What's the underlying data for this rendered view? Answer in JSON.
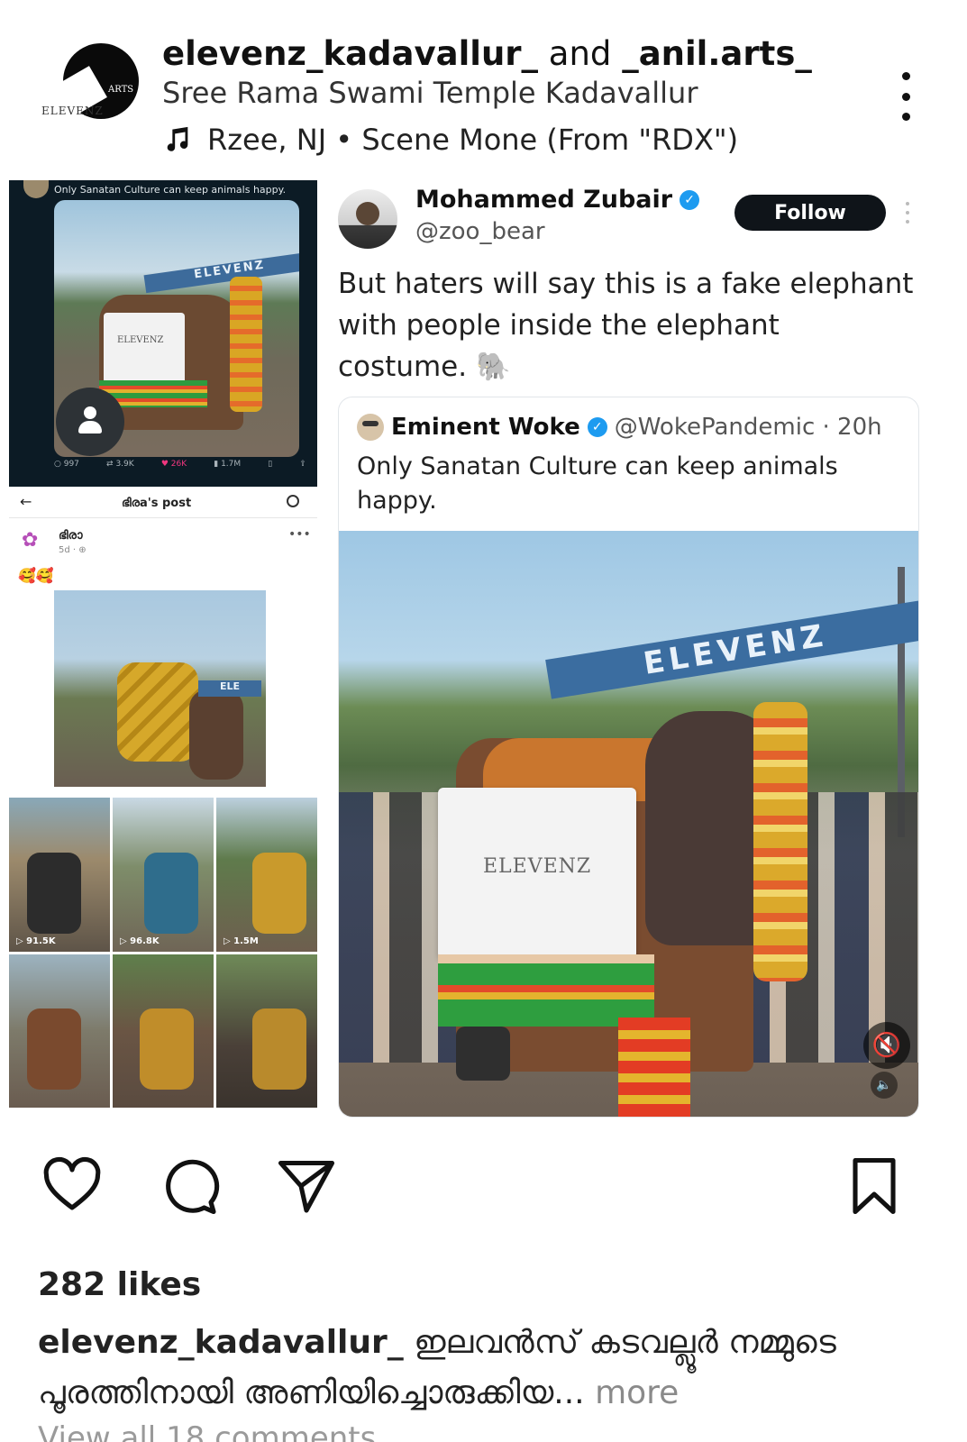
{
  "header": {
    "user_primary": "elevenz_kadavallur_",
    "joiner": "and",
    "user_secondary": "_anil.arts_",
    "location": "Sree Rama Swami Temple Kadavallur",
    "music": "Rzee, NJ • Scene Mone (From \"RDX\")",
    "avatar_text": "ELEVENZ",
    "avatar_badge": "ARTS"
  },
  "left_top": {
    "caption": "Only Sanatan Culture can keep animals happy.",
    "banner": "ELEVENZ",
    "cloth_text": "ELEVENZ",
    "stats": {
      "replies": "997",
      "reposts": "3.9K",
      "likes": "26K",
      "views": "1.7M"
    }
  },
  "left_mid": {
    "title": "ഭിരa's post",
    "name": "ഭിരാ",
    "time": "5d · ⊕",
    "emoji": "🥰🥰",
    "sign": "ELE"
  },
  "left_grid": {
    "views": [
      "▷ 91.5K",
      "▷ 96.8K",
      "▷ 1.5M"
    ]
  },
  "tweet": {
    "name": "Mohammed Zubair",
    "handle": "@zoo_bear",
    "follow_label": "Follow",
    "text": "But haters will say this is a fake elephant with people inside the elephant costume. 🐘",
    "quote": {
      "name": "Eminent Woke",
      "handle": "@WokePandemic · 20h",
      "text": "Only Sanatan Culture can keep animals happy.",
      "banner": "ELEVENZ",
      "cloth_text": "ELEVENZ"
    }
  },
  "engagement": {
    "likes": "282 likes",
    "caption_user": "elevenz_kadavallur_",
    "caption_text": "ഇലവൻസ് കടവല്ലൂർ നമ്മുടെ പൂരത്തിനായി അണിയിച്ചൊരുക്കിയ...",
    "more": "more",
    "view_all": "View all 18 comments"
  },
  "icons": {
    "like": "heart-icon",
    "comment": "comment-icon",
    "share": "send-icon",
    "save": "bookmark-icon",
    "music": "music-note-icon",
    "more": "kebab-icon"
  }
}
